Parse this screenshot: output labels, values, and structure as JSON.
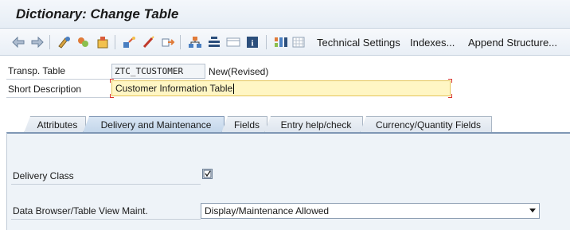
{
  "window": {
    "title": "Dictionary: Change Table"
  },
  "toolbar": {
    "icons": [
      "back-arrow-icon",
      "forward-arrow-icon",
      "other-object-icon",
      "display-change-icon",
      "activate-icon",
      "where-used-icon",
      "object-list-icon",
      "navigation-window-icon",
      "hierarchy-icon",
      "structure-icon",
      "graphic-icon",
      "info-icon",
      "table-contents-icon",
      "grid-icon"
    ],
    "buttons": {
      "technical_settings": "Technical Settings",
      "indexes": "Indexes...",
      "append_structure": "Append Structure..."
    }
  },
  "header": {
    "transp_table_label": "Transp. Table",
    "transp_table_value": "ZTC_TCUSTOMER",
    "status": "New(Revised)",
    "short_description_label": "Short Description",
    "short_description_value": "Customer Information Table"
  },
  "tabs": [
    {
      "label": "Attributes",
      "active": false
    },
    {
      "label": "Delivery and Maintenance",
      "active": true
    },
    {
      "label": "Fields",
      "active": false
    },
    {
      "label": "Entry help/check",
      "active": false
    },
    {
      "label": "Currency/Quantity Fields",
      "active": false
    }
  ],
  "delivery": {
    "delivery_class_label": "Delivery Class",
    "delivery_class_value": "",
    "browser_label": "Data Browser/Table View Maint.",
    "browser_value": "Display/Maintenance Allowed"
  },
  "colors": {
    "edit_field_bg": "#fff6c4",
    "active_tab": "#c2d5ea",
    "tab_body": "#eef3f8"
  }
}
